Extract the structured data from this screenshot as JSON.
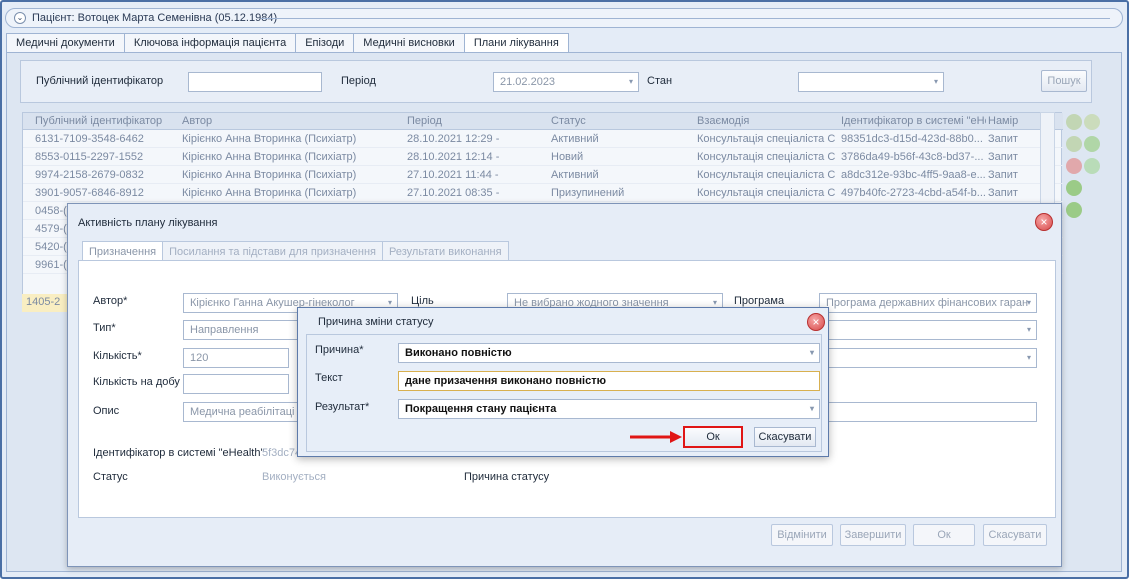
{
  "patient": {
    "title": "Пацієнт: Вотоцек Марта Семенівна (05.12.1984)"
  },
  "tabs": [
    {
      "label": "Медичні документи"
    },
    {
      "label": "Ключова інформація пацієнта"
    },
    {
      "label": "Епізоди"
    },
    {
      "label": "Медичні висновки"
    },
    {
      "label": "Плани лікування"
    }
  ],
  "filter": {
    "public_id_label": "Публічний ідентифікатор",
    "period_label": "Період",
    "period_value": "21.02.2023",
    "state_label": "Стан",
    "search_button": "Пошук"
  },
  "grid": {
    "columns": [
      "Публічний ідентифікатор",
      "Автор",
      "Період",
      "Статус",
      "Взаємодія",
      "Ідентифікатор в системі \"eHe",
      "Намір"
    ],
    "rows": [
      [
        "6131-7109-3548-6462",
        "Кірієнко Анна Вторинка (Психіатр)",
        "28.10.2021 12:29 -",
        "Активний",
        "Консультація спеціаліста С...",
        "98351dc3-d15d-423d-88b0...",
        "Запит"
      ],
      [
        "8553-0115-2297-1552",
        "Кірієнко Анна Вторинка (Психіатр)",
        "28.10.2021 12:14 -",
        "Новий",
        "Консультація спеціаліста С...",
        "3786da49-b56f-43c8-bd37-...",
        "Запит"
      ],
      [
        "9974-2158-2679-0832",
        "Кірієнко Анна Вторинка (Психіатр)",
        "27.10.2021 11:44 -",
        "Активний",
        "Консультація спеціаліста С...",
        "a8dc312e-93bc-4ff5-9aa8-e...",
        "Запит"
      ],
      [
        "3901-9057-6846-8912",
        "Кірієнко Анна Вторинка (Психіатр)",
        "27.10.2021 08:35 -",
        "Призупинений",
        "Консультація спеціаліста С...",
        "497b40fc-2723-4cbd-a54f-b...",
        "Запит"
      ]
    ],
    "partial_ids": [
      "0458-(",
      "4579-(",
      "5420-(",
      "9961-("
    ],
    "highlight_id": "1405-2"
  },
  "activity_modal": {
    "title": "Активність плану лікування",
    "tabs": [
      "Призначення",
      "Посилання та підстави для призначення",
      "Результати виконання"
    ],
    "author_label": "Автор*",
    "author_value": "Кірієнко Ганна Акушер-гінеколог",
    "goal_label": "Ціль",
    "goal_value": "Не вибрано жодного значення",
    "program_label": "Програма",
    "program_value": "Програма державних фінансових гаран",
    "type_label": "Тип*",
    "type_value": "Направлення",
    "quantity_label": "Кількість*",
    "quantity_value": "120",
    "per_day_label": "Кількість на добу",
    "description_label": "Опис",
    "description_value": "Медична реабілітаці",
    "ehealth_label": "Ідентифікатор в системі \"eHealth\"",
    "ehealth_value": "5f3dc74",
    "status_label": "Статус",
    "status_value": "Виконується",
    "status_reason_label": "Причина статусу",
    "buttons": {
      "cancel_action": "Відмінити",
      "complete": "Завершити",
      "ok": "Ок",
      "cancel": "Скасувати"
    }
  },
  "status_dialog": {
    "title": "Причина зміни статусу",
    "reason_label": "Причина*",
    "reason_value": "Виконано повністю",
    "text_label": "Текст",
    "text_value": "дане призачення виконано повністю",
    "result_label": "Результат*",
    "result_value": "Покращення стану пацієнта",
    "ok_button": "Ок",
    "cancel_button": "Скасувати"
  },
  "colors": {
    "highlight": "#e01515",
    "accent": "#4a6fa5"
  }
}
